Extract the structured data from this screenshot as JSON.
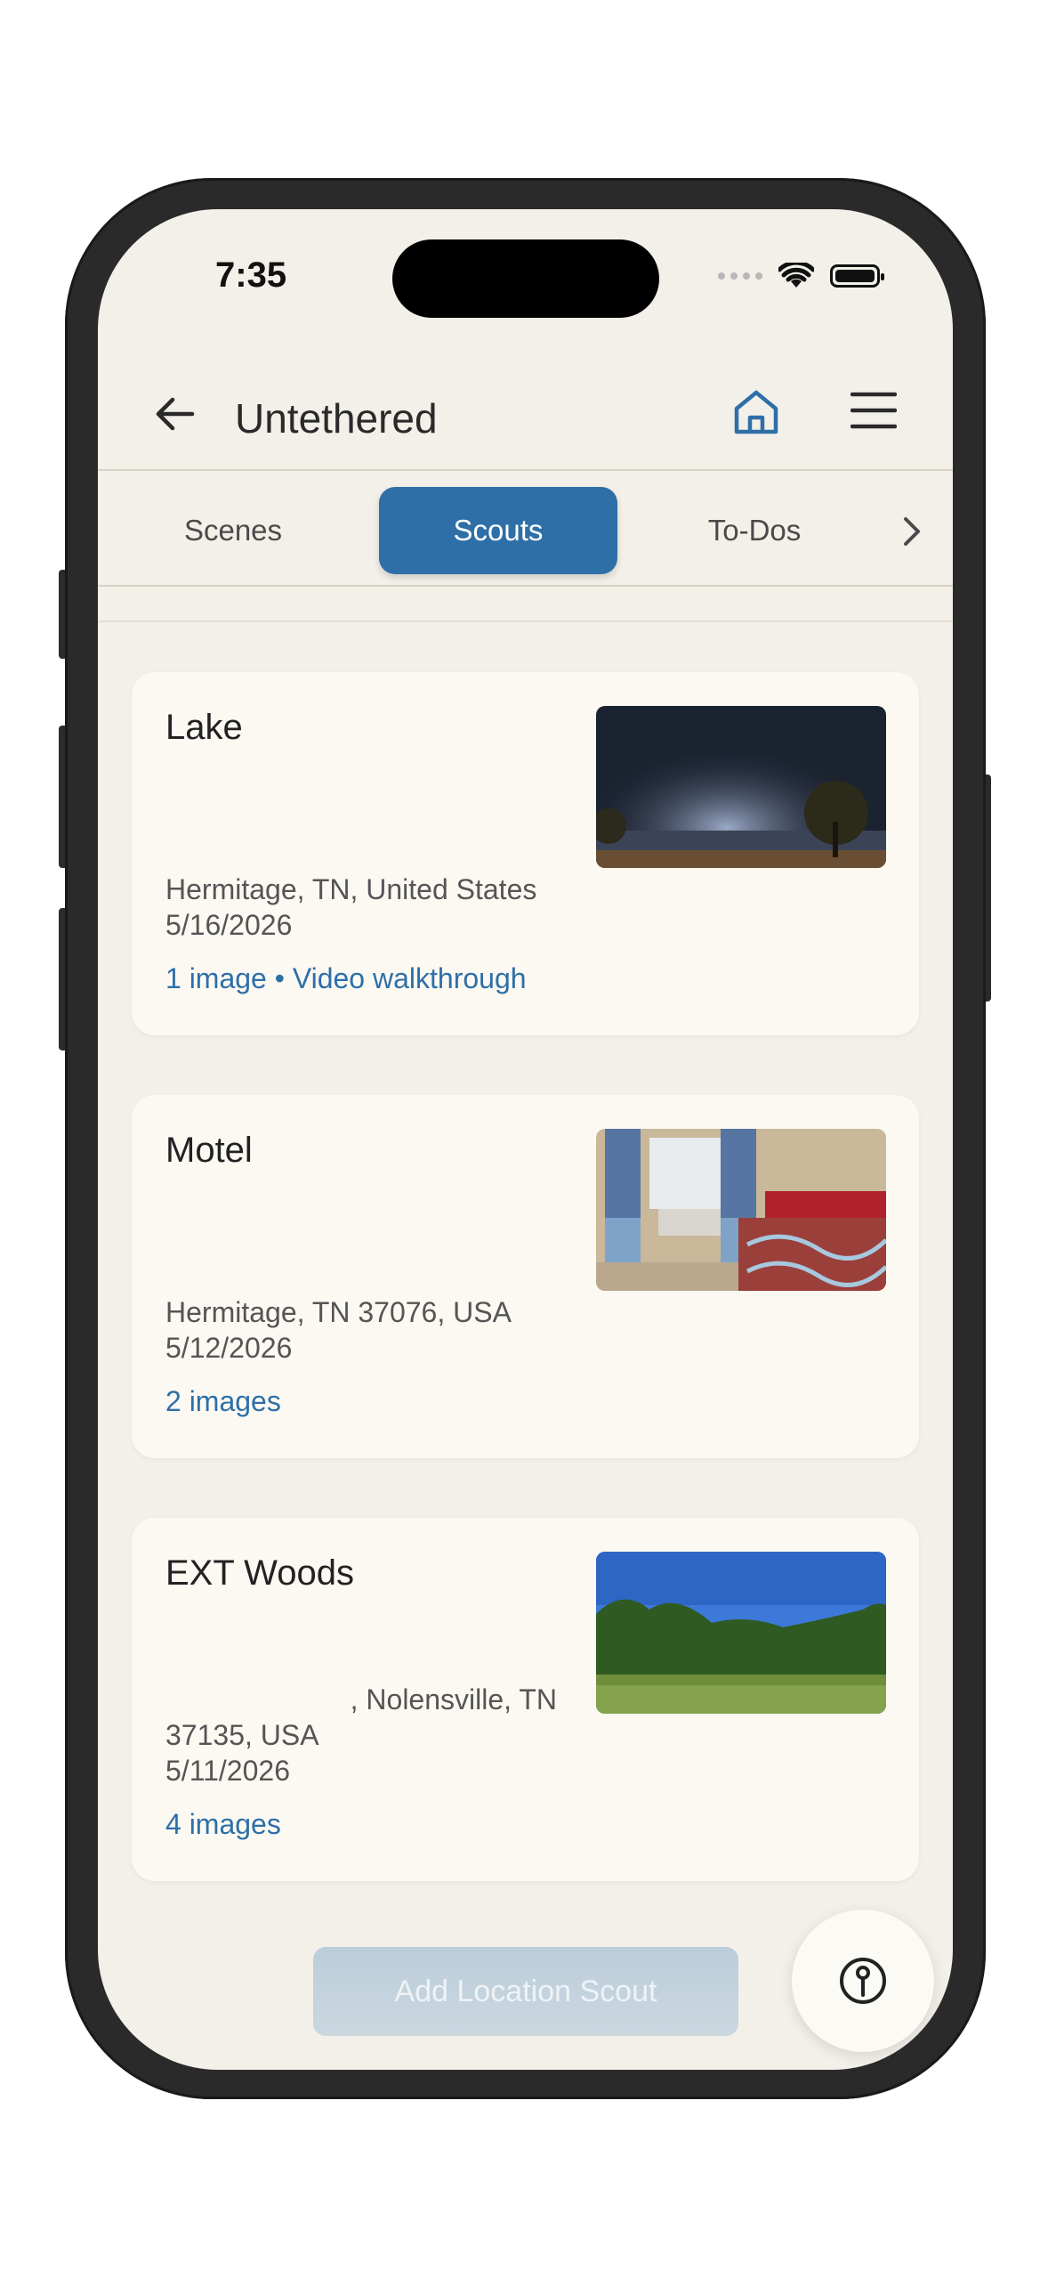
{
  "status": {
    "time": "7:35"
  },
  "header": {
    "title": "Untethered"
  },
  "tabs": [
    {
      "label": "Scenes",
      "active": false
    },
    {
      "label": "Scouts",
      "active": true
    },
    {
      "label": "To-Dos",
      "active": false
    }
  ],
  "scouts": [
    {
      "title": "Lake",
      "address": "Hermitage, TN, United States",
      "date": "5/16/2026",
      "meta": "1 image • Video walkthrough"
    },
    {
      "title": "Motel",
      "address": "Hermitage, TN 37076, USA",
      "date": "5/12/2026",
      "meta": "2 images"
    },
    {
      "title": "EXT Woods",
      "address_line1": ", Nolensville, TN",
      "address_line2": "37135, USA",
      "date": "5/11/2026",
      "meta": "4 images"
    }
  ],
  "actions": {
    "add_label": "Add Location Scout"
  },
  "colors": {
    "accent": "#2e6fa8",
    "background": "#f3f0e9",
    "card": "#fcf9f3"
  },
  "icons": [
    "back-arrow-icon",
    "home-icon",
    "hamburger-menu-icon",
    "chevron-right-icon",
    "map-pin-icon",
    "wifi-icon",
    "battery-icon"
  ]
}
